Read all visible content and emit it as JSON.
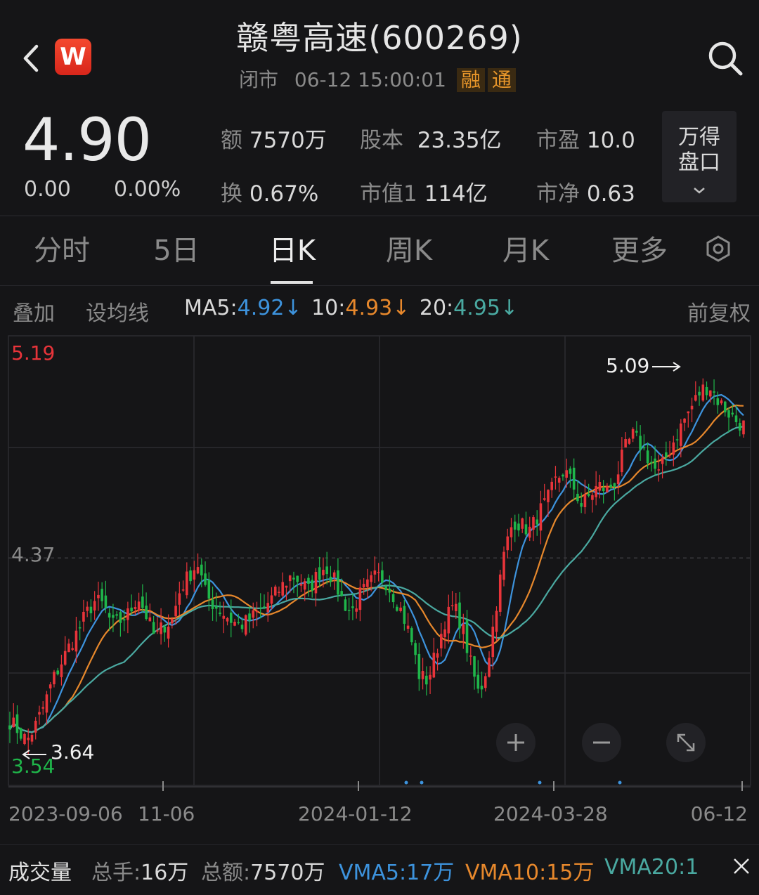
{
  "header": {
    "title": "赣粤高速(600269)",
    "status": "闭市",
    "datetime": "06-12 15:00:01",
    "badge1": "融",
    "badge2": "通"
  },
  "quote": {
    "price": "4.90",
    "change": "0.00",
    "change_pct": "0.00%",
    "amount_label": "额",
    "amount": "7570万",
    "capital_label": "股本",
    "capital": "23.35亿",
    "pe_label": "市盈",
    "pe": "10.0",
    "turnover_label": "换",
    "turnover": "0.67%",
    "mktcap_label": "市值1",
    "mktcap": "114亿",
    "pb_label": "市净",
    "pb": "0.63",
    "pankou_line1": "万得",
    "pankou_line2": "盘口"
  },
  "tabs": [
    "分时",
    "5日",
    "日K",
    "周K",
    "月K",
    "更多"
  ],
  "active_tab": "日K",
  "indicator_row": {
    "overlay": "叠加",
    "set_ma": "设均线",
    "ma5_label": "MA5:",
    "ma5": "4.92↓",
    "ma10_label": "10:",
    "ma10": "4.93↓",
    "ma20_label": "20:",
    "ma20": "4.95↓",
    "adjust": "前复权"
  },
  "colors": {
    "up": "#e8343a",
    "down": "#1fb64a",
    "ma5": "#3d93dd",
    "ma10": "#e7882c",
    "ma20": "#4aa9a1"
  },
  "chart_data": {
    "type": "candlestick",
    "y_axis_labels": [
      "5.19",
      "4.37",
      "3.54"
    ],
    "ylim": [
      3.54,
      5.19
    ],
    "annotations": [
      {
        "text": "5.09",
        "value": 5.09,
        "arrow": "right"
      },
      {
        "text": "3.64",
        "value": 3.64,
        "arrow": "left"
      }
    ],
    "x_tick_labels": [
      "2023-09-06",
      "11-06",
      "2024-01-12",
      "2024-03-28",
      "06-12"
    ],
    "close_path": [
      3.72,
      3.68,
      3.64,
      3.7,
      3.78,
      3.88,
      3.95,
      4.02,
      4.08,
      4.15,
      4.2,
      4.18,
      4.1,
      4.12,
      4.15,
      4.22,
      4.14,
      4.05,
      4.1,
      4.12,
      4.25,
      4.3,
      4.35,
      4.22,
      4.18,
      4.15,
      4.12,
      4.1,
      4.12,
      4.15,
      4.18,
      4.22,
      4.26,
      4.3,
      4.28,
      4.24,
      4.3,
      4.34,
      4.28,
      4.2,
      4.15,
      4.22,
      4.26,
      4.3,
      4.28,
      4.22,
      4.15,
      4.05,
      3.9,
      3.88,
      4.0,
      4.12,
      4.18,
      4.1,
      3.95,
      3.82,
      3.95,
      4.18,
      4.4,
      4.52,
      4.5,
      4.48,
      4.55,
      4.6,
      4.68,
      4.72,
      4.66,
      4.58,
      4.62,
      4.66,
      4.64,
      4.68,
      4.8,
      4.86,
      4.82,
      4.76,
      4.7,
      4.78,
      4.85,
      4.92,
      4.98,
      5.04,
      5.06,
      5.0,
      4.96,
      4.92,
      4.9
    ],
    "ma_series": [
      {
        "name": "MA5",
        "last": 4.92
      },
      {
        "name": "MA10",
        "last": 4.93
      },
      {
        "name": "MA20",
        "last": 4.95
      }
    ]
  },
  "volume_row": {
    "title": "成交量",
    "total_hand_label": "总手:",
    "total_hand": "16万",
    "total_amount_label": "总额:",
    "total_amount": "7570万",
    "vma5": "VMA5:17万",
    "vma10": "VMA10:15万",
    "vma20": "VMA20:1"
  }
}
